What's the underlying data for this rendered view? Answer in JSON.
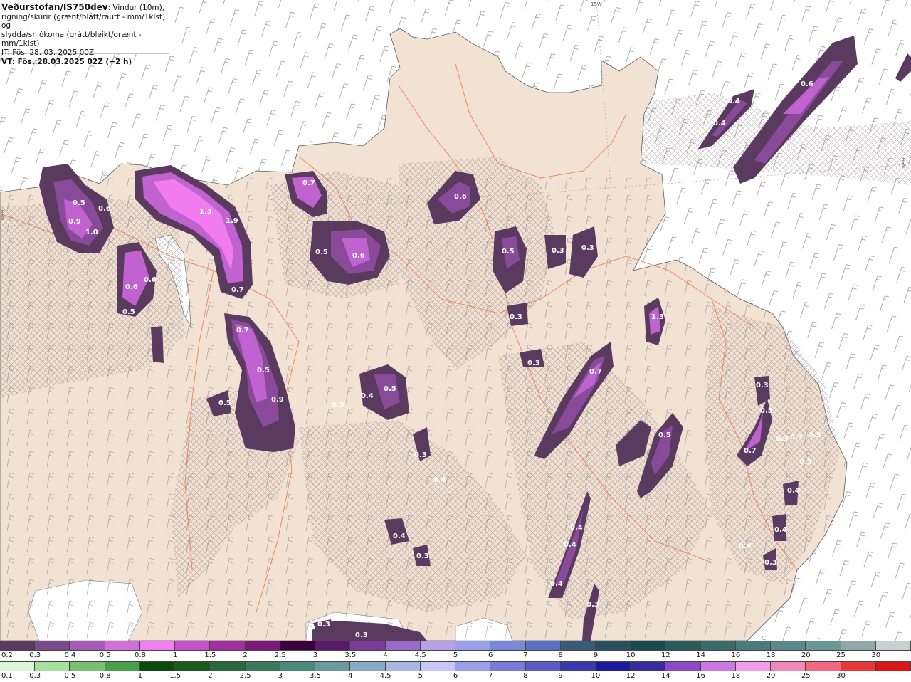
{
  "header": {
    "title": "Veðurstofan/IS750dev",
    "title_suffix": ": Vindur (10m),",
    "line2": "rigning/skúrir (grænt/blátt/rautt - mm/1klst) og",
    "line3": "slydda/snjókoma (grátt/bleikt/grænt - mm/1klst)",
    "it": "IT: Fös. 28. 03. 2025 00Z",
    "vt": "VT: Fös. 28.03.2025 02Z (+2 h)"
  },
  "grid_labels": [
    "15W",
    "N99",
    "N99"
  ],
  "precip_labels": [
    "0.5",
    "0.6",
    "0.9",
    "1.0",
    "1.3",
    "1.9",
    "0.7",
    "0.7",
    "0.6",
    "0.6",
    "0.5",
    "0.6",
    "0.6",
    "0.5",
    "0.3",
    "0.3",
    "1.3",
    "0.3",
    "0.3",
    "0.7",
    "0.5",
    "0.4",
    "0.5",
    "0.5",
    "0.9",
    "0.5",
    "0.3",
    "0.3",
    "0.4",
    "0.5",
    "0.7",
    "0.3",
    "0.5",
    "0.4",
    "0.4",
    "0.4",
    "0.4",
    "0.3",
    "0.4",
    "0.3",
    "0.3",
    "0.4",
    "0.3",
    "0.3",
    "0.4",
    "0.4",
    "0.6",
    "0.4",
    "0.3",
    "0.7",
    "0.3",
    "0.3",
    "0.3",
    "0.3"
  ],
  "colorbar_snow": {
    "labels": [
      "0.2",
      "0.3",
      "0.4",
      "0.5",
      "0.8",
      "1",
      "1.5",
      "2",
      "2.5",
      "3",
      "3.5",
      "4",
      "4.5",
      "5",
      "6",
      "7",
      "8",
      "9",
      "10",
      "12",
      "14",
      "16",
      "18",
      "20",
      "25",
      "30"
    ],
    "colors": [
      "#5a3a5e",
      "#7a4a8a",
      "#a45bb5",
      "#d070d8",
      "#f27ef2",
      "#c850c8",
      "#a030a0",
      "#7a1a7a",
      "#3a003a",
      "#5a1a6a",
      "#7a3a9a",
      "#9a6ac8",
      "#b8a0e8",
      "#9aa0e8",
      "#7a88d8",
      "#5a70c8",
      "#3a5a78",
      "#2a5060",
      "#1a4a50",
      "#2a5a5a",
      "#3a6a6a",
      "#4a7a7a",
      "#5a8888",
      "#6a9696",
      "#90a8a8",
      "#c8d0d0"
    ]
  },
  "colorbar_rain": {
    "labels": [
      "0.1",
      "0.3",
      "0.5",
      "0.8",
      "1",
      "1.5",
      "2",
      "2.5",
      "3",
      "3.5",
      "4",
      "4.5",
      "5",
      "6",
      "7",
      "8",
      "9",
      "10",
      "12",
      "14",
      "16",
      "18",
      "20",
      "25",
      "30"
    ],
    "colors": [
      "#d8f8d8",
      "#a8e0a0",
      "#78c070",
      "#48a048",
      "#0a4a0a",
      "#1a5a1a",
      "#2a6a3a",
      "#3a7a5a",
      "#4a8a7a",
      "#6a9aa0",
      "#8aa8c0",
      "#a8b8e0",
      "#c8c8f8",
      "#9aa0e8",
      "#7a7ad8",
      "#5a5ac8",
      "#3a3ab0",
      "#1a1aa0",
      "#3a2aa0",
      "#8a4ac8",
      "#c878e0",
      "#f0a0e8",
      "#f088b8",
      "#f06880",
      "#e83838",
      "#d81818"
    ]
  },
  "colors": {
    "land": "#f2e2d4",
    "sea": "#ffffff",
    "roads": "#e87a52",
    "hatch": "#8a7a7a",
    "precip_dark": "#5a3a5e",
    "precip_mid": "#8a4a9a",
    "precip_light": "#c062d0",
    "precip_bright": "#f07cf0"
  }
}
